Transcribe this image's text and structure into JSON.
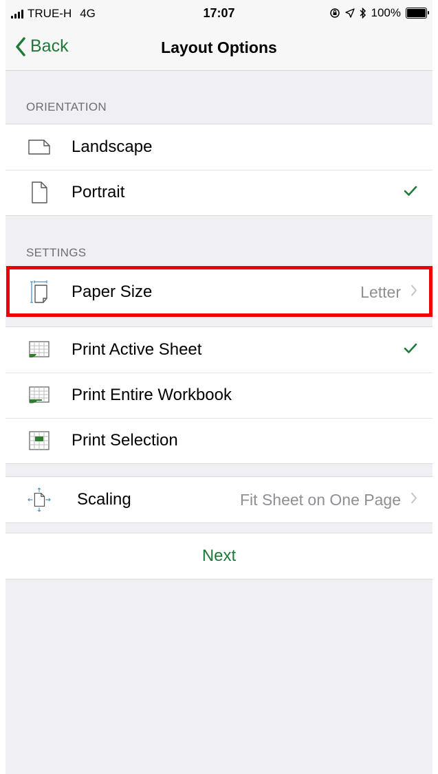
{
  "status_bar": {
    "carrier": "TRUE-H",
    "network": "4G",
    "time": "17:07",
    "battery": "100%"
  },
  "nav": {
    "back_label": "Back",
    "title": "Layout Options"
  },
  "orientation": {
    "header": "ORIENTATION",
    "items": [
      {
        "label": "Landscape",
        "icon": "landscape-page-icon",
        "checked": false
      },
      {
        "label": "Portrait",
        "icon": "portrait-page-icon",
        "checked": true
      }
    ]
  },
  "settings": {
    "header": "SETTINGS",
    "paper_size": {
      "label": "Paper Size",
      "value": "Letter",
      "icon": "paper-size-icon"
    },
    "print_items": [
      {
        "label": "Print Active Sheet",
        "icon": "sheet-icon",
        "checked": true
      },
      {
        "label": "Print Entire Workbook",
        "icon": "workbook-icon",
        "checked": false
      },
      {
        "label": "Print Selection",
        "icon": "selection-icon",
        "checked": false
      }
    ],
    "scaling": {
      "label": "Scaling",
      "value": "Fit Sheet on One Page",
      "icon": "scaling-icon"
    }
  },
  "next_label": "Next",
  "colors": {
    "accent": "#1f7a3a",
    "highlight": "#ee0000",
    "background": "#efeff4"
  }
}
